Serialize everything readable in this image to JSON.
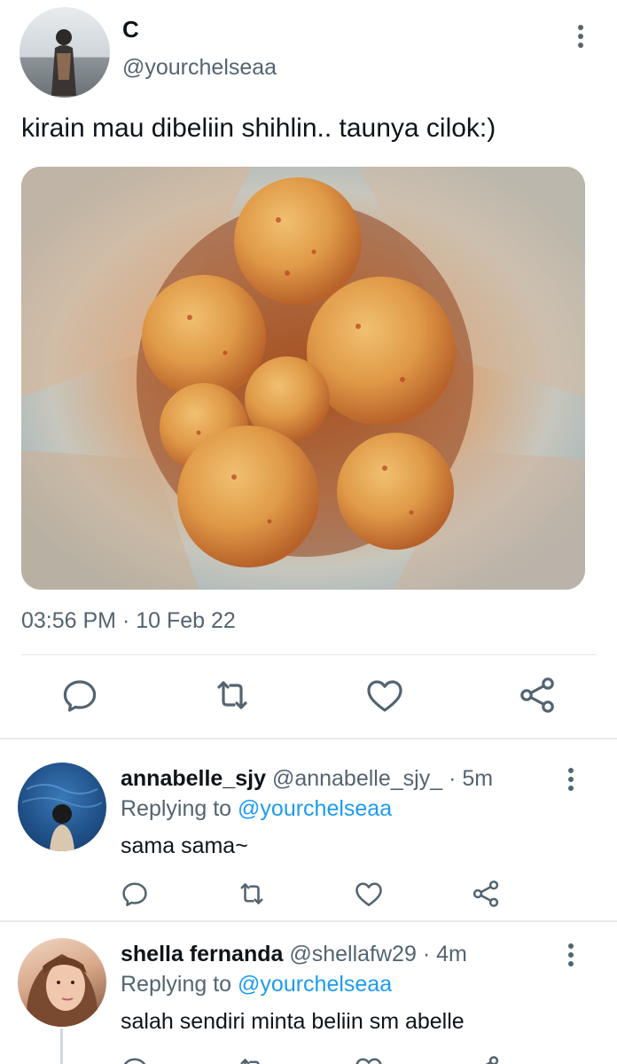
{
  "tweet": {
    "display_name": "C",
    "handle": "@yourchelseaa",
    "text": "kirain mau dibeliin shihlin.. taunya cilok:)",
    "timestamp": "03:56 PM · 10 Feb 22",
    "photo_subject": "bag of cilok balls with chili seasoning"
  },
  "icons": {
    "reply": "reply-icon",
    "retweet": "retweet-icon",
    "like": "heart-icon",
    "share": "share-icon",
    "more": "more-options-icon"
  },
  "replies": [
    {
      "name": "annabelle_sjy",
      "handle": "@annabelle_sjy_",
      "time": "· 5m",
      "replying_label": "Replying to",
      "replying_to": "@yourchelseaa",
      "text": "sama sama~"
    },
    {
      "name": "shella fernanda",
      "handle": "@shellafw29",
      "time": "· 4m",
      "replying_label": "Replying to",
      "replying_to": "@yourchelseaa",
      "text": "salah sendiri minta beliin sm abelle"
    }
  ],
  "colors": {
    "text_primary": "#0f1419",
    "text_secondary": "#536471",
    "accent": "#1d9bf0",
    "divider": "#e1e6ea"
  }
}
